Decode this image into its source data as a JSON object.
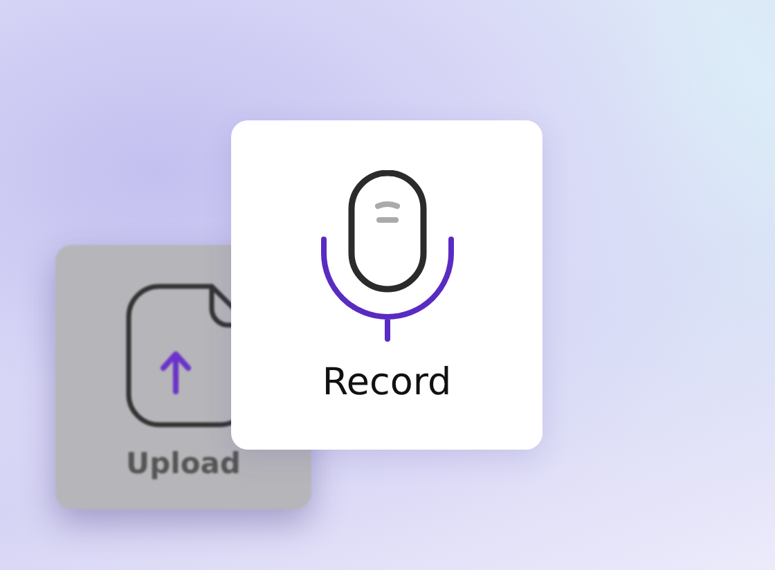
{
  "tiles": [
    {
      "kind": "upload",
      "label": "Upload",
      "selected": false
    },
    {
      "kind": "record",
      "label": "Record",
      "selected": true
    }
  ]
}
